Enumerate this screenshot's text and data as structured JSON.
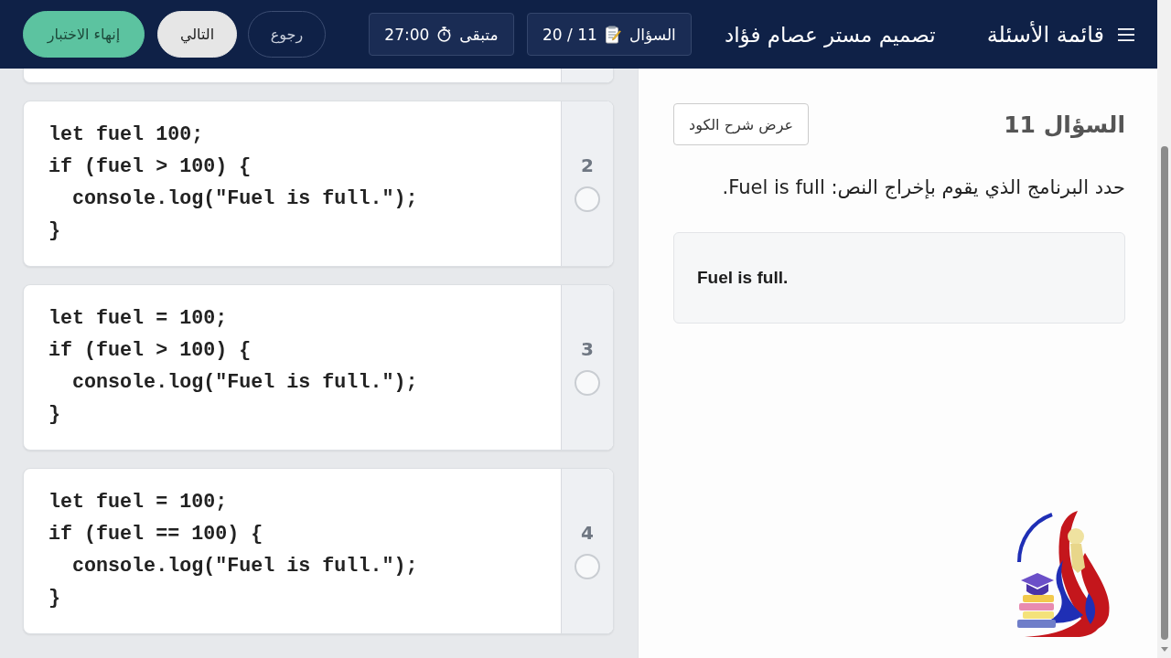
{
  "header": {
    "menu_label": "قائمة الأسئلة",
    "title": "تصميم مستر عصام فؤاد",
    "counter": {
      "label": "السؤال",
      "value": "11 / 20"
    },
    "timer": {
      "label": "متبقى",
      "value": "27:00"
    },
    "buttons": [
      {
        "label": "رجوع",
        "kind": "outline"
      },
      {
        "label": "التالي",
        "kind": "light"
      },
      {
        "label": "إنهاء الاختبار",
        "kind": "success"
      }
    ]
  },
  "options_panel": {
    "clipped_card_above": true,
    "options": [
      {
        "number": "2",
        "code": "let fuel 100;\nif (fuel > 100) {\n  console.log(\"Fuel is full.\");\n}",
        "selected": false
      },
      {
        "number": "3",
        "code": "let fuel = 100;\nif (fuel > 100) {\n  console.log(\"Fuel is full.\");\n}",
        "selected": false
      },
      {
        "number": "4",
        "code": "let fuel = 100;\nif (fuel == 100) {\n  console.log(\"Fuel is full.\");\n}",
        "selected": false
      }
    ]
  },
  "question": {
    "heading": "السؤال 11",
    "explain_button": "عرض شرح الكود",
    "prompt": "حدد البرنامج الذي يقوم بإخراج النص: Fuel is full.",
    "output": "Fuel is full."
  }
}
